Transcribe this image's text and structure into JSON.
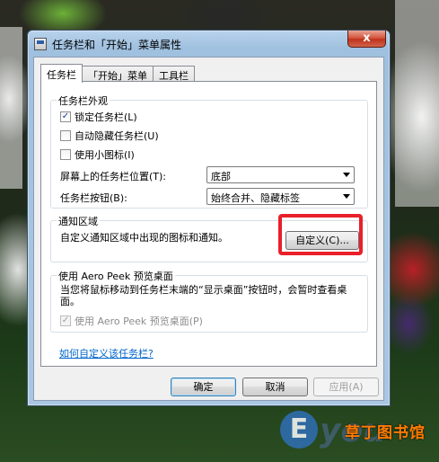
{
  "window": {
    "title": "任务栏和「开始」菜单属性",
    "close_glyph": "x"
  },
  "tabs": [
    {
      "label": "任务栏",
      "active": true
    },
    {
      "label": "「开始」菜单",
      "active": false
    },
    {
      "label": "工具栏",
      "active": false
    }
  ],
  "appearance": {
    "legend": "任务栏外观",
    "lock_label": "锁定任务栏(L)",
    "lock_checked": true,
    "autohide_label": "自动隐藏任务栏(U)",
    "autohide_checked": false,
    "small_icons_label": "使用小图标(I)",
    "small_icons_checked": false,
    "location_label": "屏幕上的任务栏位置(T):",
    "location_value": "底部",
    "buttons_label": "任务栏按钮(B):",
    "buttons_value": "始终合并、隐藏标签"
  },
  "notification": {
    "legend": "通知区域",
    "description": "自定义通知区域中出现的图标和通知。",
    "customize_button": "自定义(C)..."
  },
  "aero": {
    "legend": "使用 Aero Peek 预览桌面",
    "description": "当您将鼠标移动到任务栏末端的“显示桌面”按钮时，会暂时查看桌面。",
    "checkbox_label": "使用 Aero Peek 预览桌面(P)",
    "checked": true,
    "disabled": true
  },
  "help_link": "如何自定义该任务栏?",
  "footer": {
    "ok": "确定",
    "cancel": "取消",
    "apply": "应用(A)"
  },
  "watermark": {
    "letter": "E",
    "text": "you",
    "site": "草丁图书馆"
  },
  "colors": {
    "highlight": "#e8202a",
    "link": "#0066cc"
  }
}
